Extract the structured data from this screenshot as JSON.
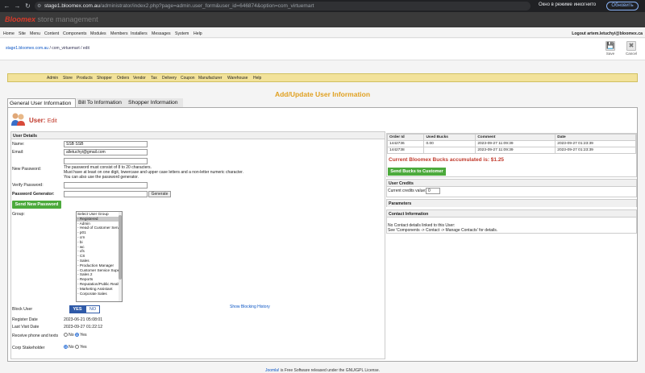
{
  "browser": {
    "url_host": "stage1.bloomex.com.au",
    "url_path": "/administrator/index2.php?page=admin.user_form&user_id=646874&option=com_virtuemart",
    "incognito_label": "Окно в режиме инкогнито",
    "update_label": "Обновить"
  },
  "header": {
    "brand": "Bloomex",
    "brand_sub": "store management"
  },
  "admin_menu": {
    "items": [
      "Home",
      "Site",
      "Menu",
      "Content",
      "Components",
      "Modules",
      "Members",
      "Installers",
      "Messages",
      "System",
      "Help"
    ],
    "logout": "Logout artem.letuchyi@bloomex.ca"
  },
  "breadcrumb": {
    "site": "stage1.bloomex.com.au",
    "rest": " / com_virtuemart / edit"
  },
  "toolbar": {
    "save_label": "Save",
    "cancel_label": "Cancel"
  },
  "vm_menu": {
    "items": [
      "Admin",
      "Store",
      "Products",
      "Shopper",
      "Orders",
      "Vendor",
      "Tax",
      "Delivery",
      "Coupon",
      "Manufacturer",
      "Warehouse",
      "Help"
    ]
  },
  "form": {
    "title": "Add/Update User Information",
    "tabs": [
      "General User Information",
      "Bill To Information",
      "Shopper Information"
    ],
    "user_heading": "User:",
    "user_heading_mode": "Edit"
  },
  "user_details": {
    "section_title": "User Details",
    "name_label": "Name:",
    "name_value": "SSB SSB",
    "email_label": "Email:",
    "email_value": "alletuchyi@gmail.com",
    "new_password_label": "New Password:",
    "password_note_1": "The password must consist of 8 to 20 characters.",
    "password_note_2": "Must have at least on one digit, lowercase and upper case letters and a non-letter numeric character.",
    "password_note_3": "You can also use the password generator.",
    "verify_password_label": "Verify Password:",
    "password_generator_label": "Password Generator:",
    "generate_label": "Generate",
    "send_new_password_label": "Send New Password",
    "group_label": "Group:",
    "group_options": [
      "Select User Group",
      "- Registered",
      "- Admin",
      "- Head of Customer Service",
      "- p01",
      "- crn",
      "- bi",
      "- wc",
      "- cfs",
      "- CS",
      "- Sales",
      "- Production Manager",
      "- Customer Service Supervisor",
      "- Sales 2",
      "- Reports",
      "- Reputation/Public Realtions",
      "- Marketing Assistant",
      "- Corporate Sales"
    ],
    "group_selected_index": 1,
    "block_user_label": "Block User",
    "yes_label": "YES",
    "no_label": "NO",
    "show_blocking_label": "Show Blocking History",
    "register_date_label": "Register Date",
    "register_date_value": "2023-06-21 05:08:01",
    "last_visit_label": "Last Visit Date",
    "last_visit_value": "2023-09-27 01:22:12",
    "receive_label": "Receive phone and texts",
    "corp_label": "Corp Stakeholder",
    "radio_no": "No",
    "radio_yes": "Yes"
  },
  "orders": {
    "headers": [
      "Order Id",
      "Used Bucks",
      "Comment",
      "Date"
    ],
    "rows": [
      [
        "1442736",
        "0.00",
        "2023-09-27 11:09:39",
        "2023-09-27 01:23:39"
      ],
      [
        "1442738",
        "",
        "2023-09-27 11:09:39",
        "2023-09-27 01:23:39"
      ]
    ],
    "bucks_text": "Current Bloomex Bucks accumulated is: $1.25",
    "send_bucks_label": "Send Bucks to Customer"
  },
  "credits": {
    "title": "User Credits",
    "current_label": "Current credits value:",
    "current_value": "0"
  },
  "parameters": {
    "title": "Parameters"
  },
  "contact": {
    "title": "Contact Information",
    "line1": "No Contact details linked to this User:",
    "line2": "See 'Components -> Contact -> Manage Contacts' for details."
  },
  "footer": {
    "link": "Joomla!",
    "text": " is Free Software released under the GNU/GPL License."
  }
}
